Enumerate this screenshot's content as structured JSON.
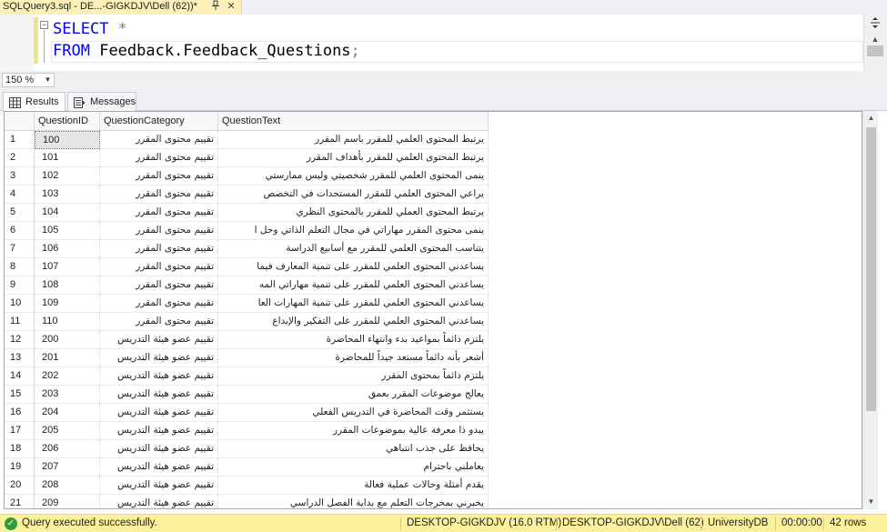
{
  "tab": {
    "title": "SQLQuery3.sql - DE...-GIGKDJV\\Dell (62))*",
    "pin_icon": "pin-icon",
    "close_icon": "close-icon"
  },
  "editor": {
    "collapse_glyph": "−",
    "line1": {
      "kw": "SELECT",
      "rest": "*"
    },
    "line2": {
      "kw": "FROM",
      "table": "Feedback.Feedback_Questions",
      "semi": ";"
    }
  },
  "zoom": {
    "value": "150 %"
  },
  "results_tabs": [
    {
      "label": "Results",
      "icon": "grid-icon",
      "active": true
    },
    {
      "label": "Messages",
      "icon": "messages-icon",
      "active": false
    }
  ],
  "grid": {
    "columns": [
      "QuestionID",
      "QuestionCategory",
      "QuestionText"
    ],
    "rows": [
      {
        "n": "1",
        "id": "100",
        "cat": "تقييم محتوى المقرر",
        "text": "يرتبط المحتوى العلمي للمقرر باسم المقرر"
      },
      {
        "n": "2",
        "id": "101",
        "cat": "تقييم محتوى المقرر",
        "text": "يرتبط المحتوى العلمي للمقرر بأهداف المقرر"
      },
      {
        "n": "3",
        "id": "102",
        "cat": "تقييم محتوى المقرر",
        "text": "ينمى المحتوى العلمي للمقرر شخصيتي وليس ممارستي"
      },
      {
        "n": "4",
        "id": "103",
        "cat": "تقييم محتوى المقرر",
        "text": "يراعي المحتوى العلمي للمقرر المستجدات في التخصص"
      },
      {
        "n": "5",
        "id": "104",
        "cat": "تقييم محتوى المقرر",
        "text": "يرتبط المحتوى العملي للمقرر بالمحتوى النظري"
      },
      {
        "n": "6",
        "id": "105",
        "cat": "تقييم محتوى المقرر",
        "text": "ينمى محتوى المقرر مهاراتي في مجال التعلم الذاتي وحل ا"
      },
      {
        "n": "7",
        "id": "106",
        "cat": "تقييم محتوى المقرر",
        "text": "يتناسب المحتوى العلمي للمقرر مع أسابيع الدراسة"
      },
      {
        "n": "8",
        "id": "107",
        "cat": "تقييم محتوى المقرر",
        "text": "يساعدني المحتوى العلمي للمقرر على تنمية المعارف فيما"
      },
      {
        "n": "9",
        "id": "108",
        "cat": "تقييم محتوى المقرر",
        "text": "يساعدني المحتوى العلمي للمقرر على تنمية مهاراتي المه"
      },
      {
        "n": "10",
        "id": "109",
        "cat": "تقييم محتوى المقرر",
        "text": "يساعدني المحتوى العلمي للمقرر على تنمية المهارات العا"
      },
      {
        "n": "11",
        "id": "110",
        "cat": "تقييم محتوى المقرر",
        "text": "يساعدني المحتوى العلمي للمقرر على التفكير والإبداع"
      },
      {
        "n": "12",
        "id": "200",
        "cat": "تقييم عضو هيئة التدريس",
        "text": "يلتزم دائماً بمواعيد بدء وانتهاء المحاضرة"
      },
      {
        "n": "13",
        "id": "201",
        "cat": "تقييم عضو هيئة التدريس",
        "text": "أشعر بأنه دائماً مستعد جيداً للمحاضرة"
      },
      {
        "n": "14",
        "id": "202",
        "cat": "تقييم عضو هيئة التدريس",
        "text": "يلتزم دائماً بمحتوى المقرر"
      },
      {
        "n": "15",
        "id": "203",
        "cat": "تقييم عضو هيئة التدريس",
        "text": "يعالج موضوعات المقرر بعمق"
      },
      {
        "n": "16",
        "id": "204",
        "cat": "تقييم عضو هيئة التدريس",
        "text": "يستثمر وقت المحاضرة في التدريس الفعلي"
      },
      {
        "n": "17",
        "id": "205",
        "cat": "تقييم عضو هيئة التدريس",
        "text": "يبدو ذا معرفة عالية بموضوعات المقرر"
      },
      {
        "n": "18",
        "id": "206",
        "cat": "تقييم عضو هيئة التدريس",
        "text": "يحافظ على جذب انتباهي"
      },
      {
        "n": "19",
        "id": "207",
        "cat": "تقييم عضو هيئة التدريس",
        "text": "يعاملني باحترام"
      },
      {
        "n": "20",
        "id": "208",
        "cat": "تقييم عضو هيئة التدريس",
        "text": "يقدم أمثلة وحالات عملية فعالة"
      },
      {
        "n": "21",
        "id": "209",
        "cat": "تقييم عضو هيئة التدريس",
        "text": "يخبرني بمخرجات التعلم مع بداية الفصل الدراسي"
      }
    ]
  },
  "status": {
    "icon": "check-circle-icon",
    "message": "Query executed successfully.",
    "server": "DESKTOP-GIGKDJV (16.0 RTM)",
    "user": "DESKTOP-GIGKDJV\\Dell (62)",
    "database": "UniversityDB",
    "elapsed": "00:00:00",
    "rows": "42 rows"
  },
  "colors": {
    "status_bg": "#fcf29c",
    "tab_bg": "#fdf1b9",
    "keyword": "#0000ff",
    "success": "#2e9e38"
  }
}
